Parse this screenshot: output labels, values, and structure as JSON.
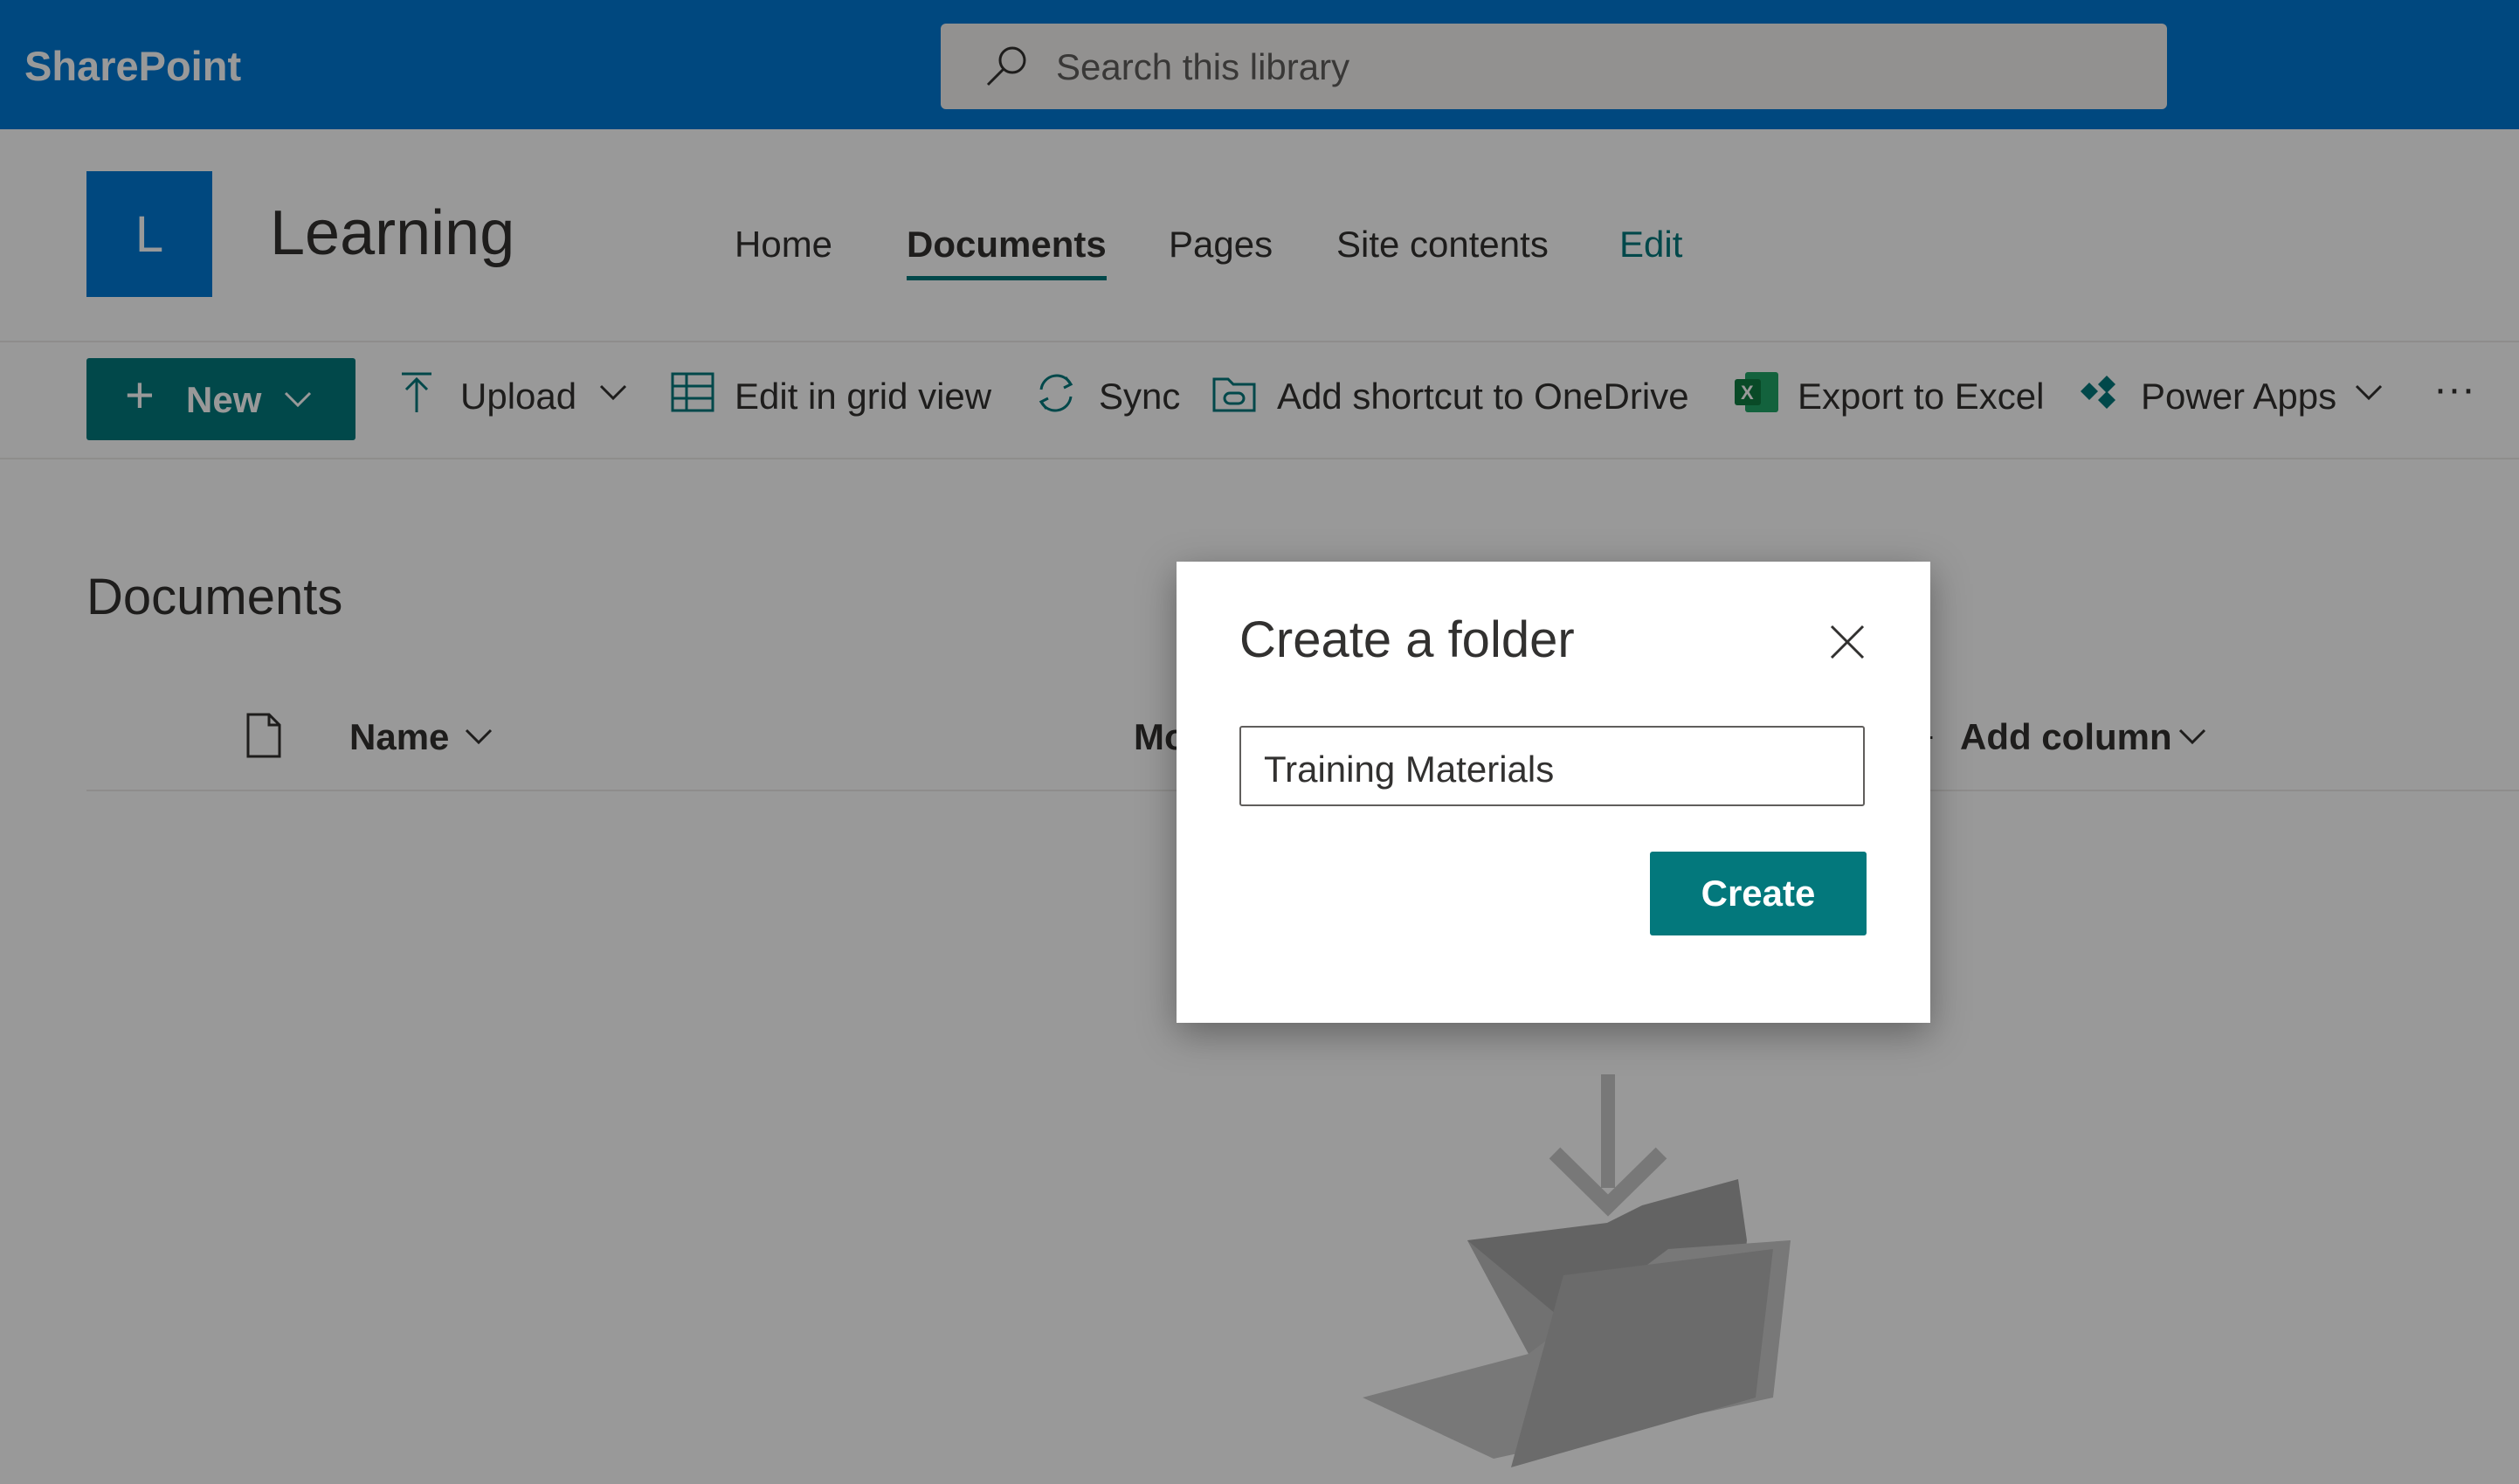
{
  "app": {
    "brand": "SharePoint"
  },
  "search": {
    "placeholder": "Search this library"
  },
  "site": {
    "logo_letter": "L",
    "title": "Learning"
  },
  "nav": [
    {
      "label": "Home"
    },
    {
      "label": "Documents",
      "active": true
    },
    {
      "label": "Pages"
    },
    {
      "label": "Site contents"
    },
    {
      "label": "Edit"
    }
  ],
  "toolbar": {
    "new_label": "New",
    "upload_label": "Upload",
    "grid_label": "Edit in grid view",
    "sync_label": "Sync",
    "shortcut_label": "Add shortcut to OneDrive",
    "excel_label": "Export to Excel",
    "powerapps_label": "Power Apps",
    "more_label": "···"
  },
  "library": {
    "title": "Documents",
    "columns": {
      "name": "Name",
      "modified_partial": "Mo",
      "add_column": "Add column"
    }
  },
  "dialog": {
    "title": "Create a folder",
    "input_value": "Training Materials",
    "create_label": "Create"
  },
  "colors": {
    "suite_bar": "#0078d4",
    "accent": "#03787c",
    "overlay": "rgba(0,0,0,0.40)"
  },
  "icons": [
    "search-icon",
    "plus-icon",
    "chevron-down-icon",
    "upload-icon",
    "grid-icon",
    "sync-icon",
    "shortcut-icon",
    "excel-icon",
    "power-apps-icon",
    "more-icon",
    "file-icon",
    "close-icon",
    "empty-folder-illustration"
  ]
}
